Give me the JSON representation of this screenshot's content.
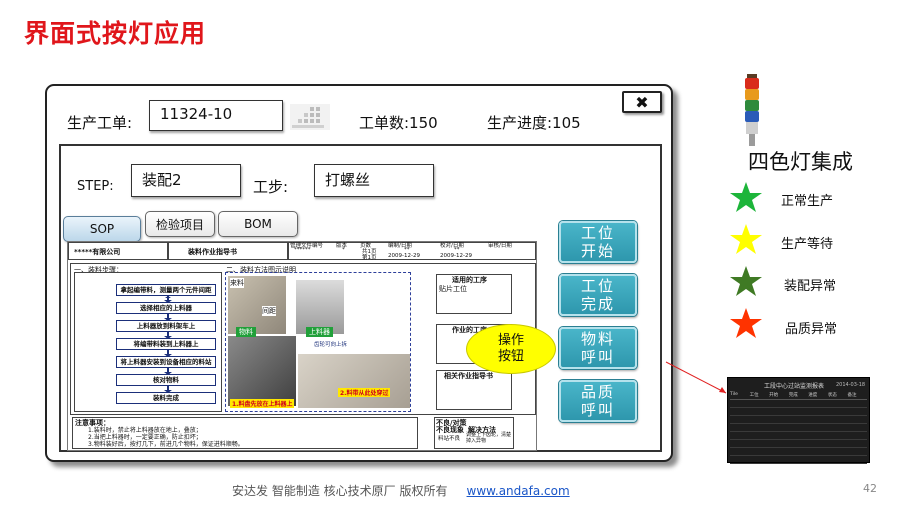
{
  "slide": {
    "title": "界面式按灯应用",
    "page_number": "42"
  },
  "window": {
    "work_order_label": "生产工单:",
    "work_order_value": "11324-10",
    "quantity_label": "工单数:150",
    "progress_label": "生产进度:105",
    "close_label": "✖",
    "step_label": "STEP:",
    "step_value": "装配2",
    "work_step_label": "工步:",
    "work_step_value": "打螺丝",
    "tabs": [
      {
        "label": "SOP",
        "active": true
      },
      {
        "label": "检验项目",
        "active": false
      },
      {
        "label": "BOM",
        "active": false
      }
    ]
  },
  "sop_doc": {
    "company": "*****有限公司",
    "doc_title": "装料作业指导书",
    "header_cols": [
      "管理文件编号",
      "版本",
      "页数",
      "编制/日期",
      "校对/日期",
      "审核/日期"
    ],
    "header_row1": [
      "******",
      "*",
      "共1页",
      "**",
      "**",
      ""
    ],
    "header_row2": [
      "",
      "",
      "第1页",
      "2009-12-29",
      "2009-12-29",
      ""
    ],
    "section1": "一、装料步骤：",
    "section2": "二、装料方法图示说明",
    "steps": [
      "拿起编带料，测量两个元件间距",
      "选择相应的上料器",
      "上料器放到料架车上",
      "将编带料装到上料器上",
      "将上料器安装到设备相应的料站",
      "核对物料",
      "装料完成"
    ],
    "photo_labels": [
      "来料",
      "间距",
      "物料",
      "上料器",
      "齿轮可向上拆",
      "1.料盘先放在上料器上",
      "2.料带从此处穿过"
    ],
    "right_headers": [
      "适用的工序",
      "贴片工位",
      "作业的工序",
      "相关作业指导书"
    ],
    "notes_title": "注意事项：",
    "notes": [
      "1.装料时，禁止将上料器放在地上，叠放；",
      "2.当把上料器时，一定要正确，防止扣坏；",
      "3.物料装好后，按打几下，前进几个物料，保证进料顺畅。"
    ],
    "bad_title": "不良/对策",
    "bad_cols": [
      "不良现象",
      "解决方法"
    ],
    "bad_row": [
      "料站不良",
      "调整上下齿轮，清楚掉入异物"
    ]
  },
  "actions": [
    {
      "label": "工位开始"
    },
    {
      "label": "工位完成"
    },
    {
      "label": "物料呼叫"
    },
    {
      "label": "品质呼叫"
    }
  ],
  "callout": "操作按钮",
  "signal_tower": {
    "title": "四色灯集成",
    "legend": [
      {
        "label": "正常生产",
        "color": "#1db53a"
      },
      {
        "label": "生产等待",
        "color": "#ffff00"
      },
      {
        "label": "装配异常",
        "color": "#3f7a24"
      },
      {
        "label": "品质异常",
        "color": "#ff3300"
      }
    ],
    "light_colors": [
      "#d92c1b",
      "#e89a1c",
      "#2f8a3c",
      "#2a5bb8"
    ]
  },
  "dashboard": {
    "title": "工段中心过站监测报表",
    "date": "2014-03-18",
    "columns": [
      "Tile",
      "工位",
      "开始",
      "完成",
      "进度",
      "状态",
      "备注"
    ]
  },
  "footer": {
    "text": "安达发   智能制造 核心技术原厂   版权所有",
    "link": "www.andafa.com"
  }
}
